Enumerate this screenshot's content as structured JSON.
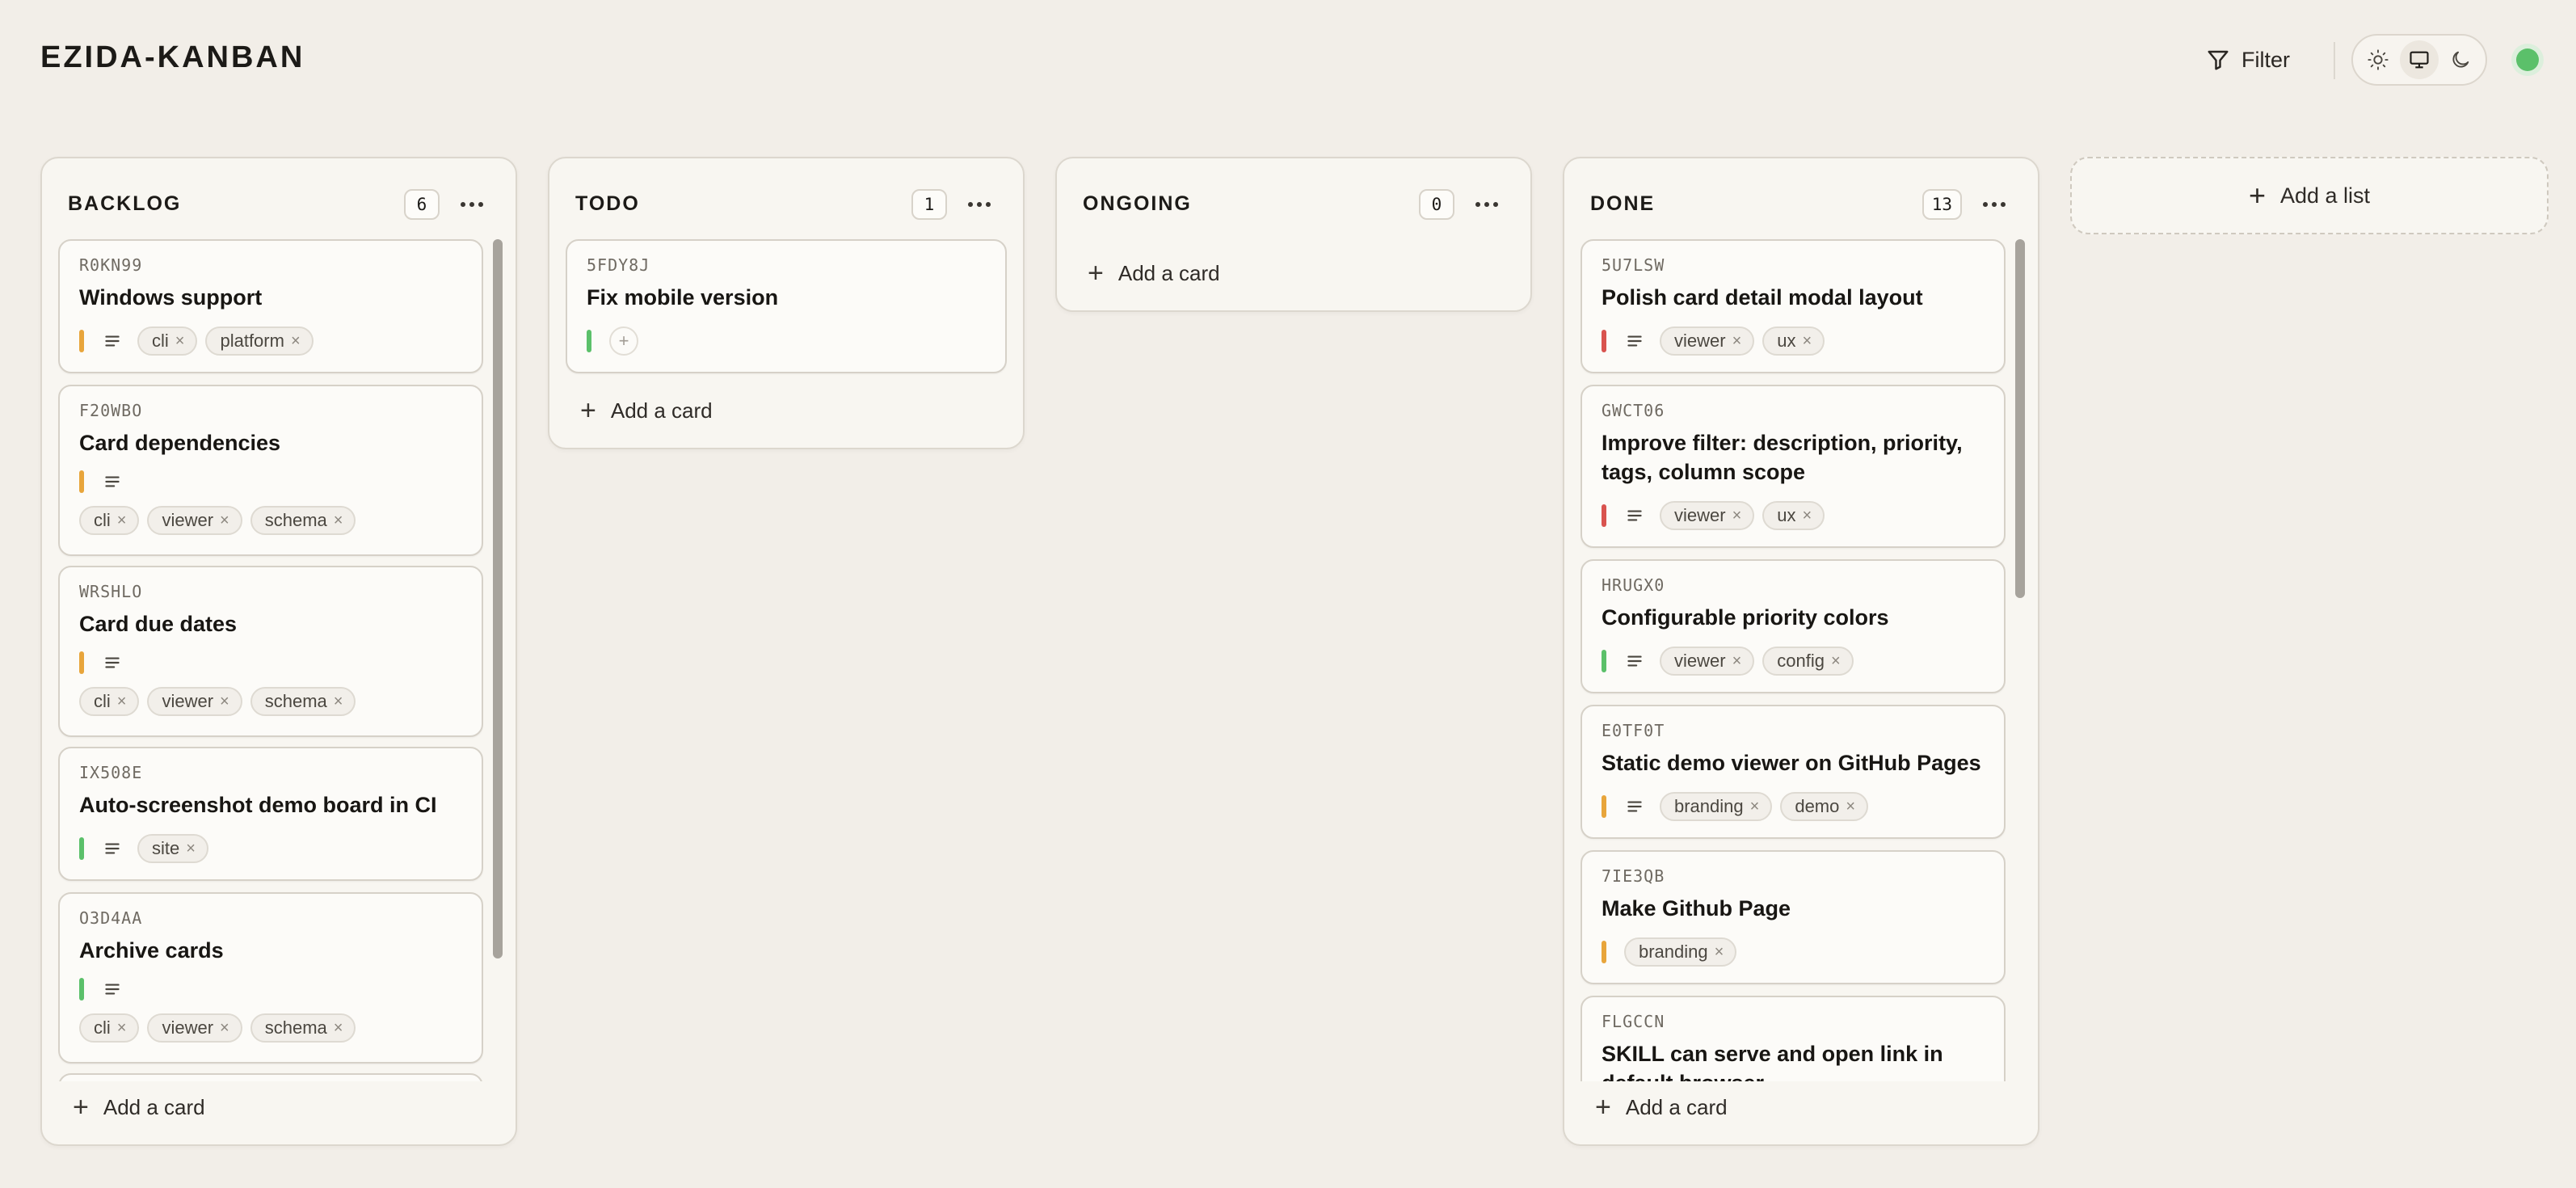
{
  "app": {
    "title": "EZIDA-KANBAN",
    "filter_label": "Filter",
    "status_color": "#5bc06a"
  },
  "theme_options": [
    "sun-icon",
    "monitor-icon",
    "moon-icon"
  ],
  "priority_colors": {
    "high": "#d9534f",
    "medium": "#e8a53b",
    "low": "#5bc06a"
  },
  "add_card_label": "Add a card",
  "add_list_label": "Add a list",
  "columns": [
    {
      "title": "BACKLOG",
      "count": "6",
      "cards": [
        {
          "id": "R0KN99",
          "title": "Windows support",
          "priority": "medium",
          "tags": [
            "cli",
            "platform"
          ]
        },
        {
          "id": "F20WBO",
          "title": "Card dependencies",
          "priority": "medium",
          "tags": [
            "cli",
            "viewer",
            "schema"
          ]
        },
        {
          "id": "WRSHLO",
          "title": "Card due dates",
          "priority": "medium",
          "tags": [
            "cli",
            "viewer",
            "schema"
          ]
        },
        {
          "id": "IX508E",
          "title": "Auto-screenshot demo board in CI",
          "priority": "low",
          "tags": [
            "site"
          ]
        },
        {
          "id": "O3D4AA",
          "title": "Archive cards",
          "priority": "low",
          "tags": [
            "cli",
            "viewer",
            "schema"
          ]
        }
      ]
    },
    {
      "title": "TODO",
      "count": "1",
      "cards": [
        {
          "id": "5FDY8J",
          "title": "Fix mobile version",
          "priority": "low",
          "tags": []
        }
      ]
    },
    {
      "title": "ONGOING",
      "count": "0",
      "cards": []
    },
    {
      "title": "DONE",
      "count": "13",
      "cards": [
        {
          "id": "5U7LSW",
          "title": "Polish card detail modal layout",
          "priority": "high",
          "tags": [
            "viewer",
            "ux"
          ]
        },
        {
          "id": "GWCT06",
          "title": "Improve filter: description, priority, tags, column scope",
          "priority": "high",
          "tags": [
            "viewer",
            "ux"
          ]
        },
        {
          "id": "HRUGX0",
          "title": "Configurable priority colors",
          "priority": "low",
          "tags": [
            "viewer",
            "config"
          ]
        },
        {
          "id": "E0TF0T",
          "title": "Static demo viewer on GitHub Pages",
          "priority": "medium",
          "tags": [
            "branding",
            "demo"
          ]
        },
        {
          "id": "7IE3QB",
          "title": "Make Github Page",
          "priority": "medium",
          "tags": [
            "branding"
          ]
        },
        {
          "id": "FLGCCN",
          "title": "SKILL can serve and open link in default browser",
          "priority": "medium",
          "tags": []
        }
      ]
    }
  ]
}
